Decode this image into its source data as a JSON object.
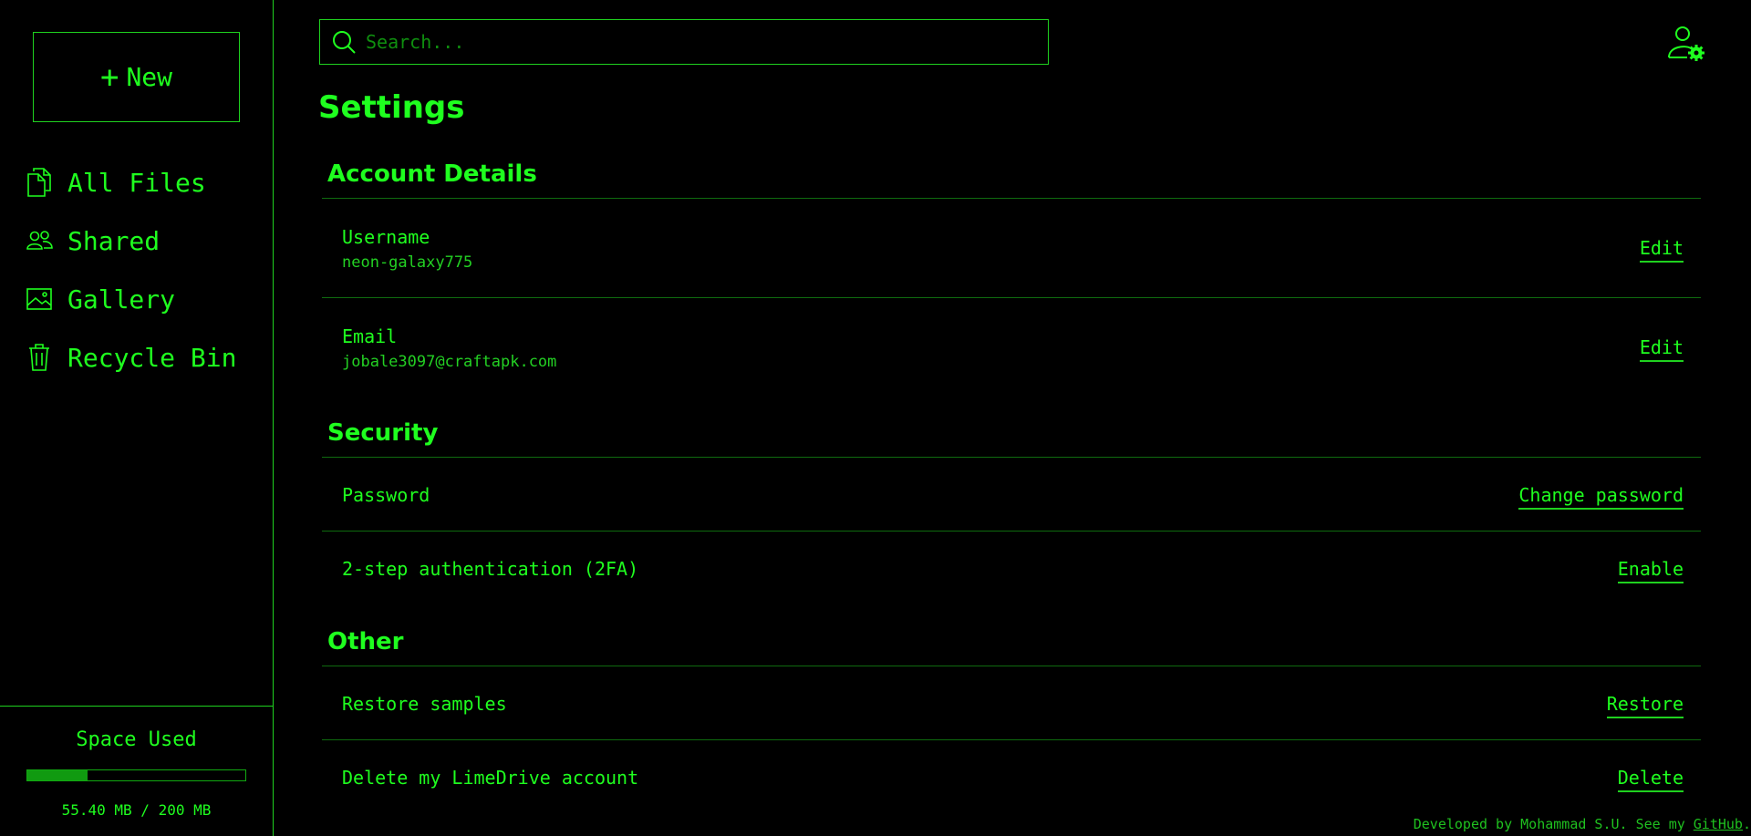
{
  "sidebar": {
    "new_label": "New",
    "items": [
      {
        "label": "All Files",
        "icon": "files-icon"
      },
      {
        "label": "Shared",
        "icon": "users-icon"
      },
      {
        "label": "Gallery",
        "icon": "image-icon"
      },
      {
        "label": "Recycle Bin",
        "icon": "trash-icon"
      }
    ],
    "space": {
      "title": "Space Used",
      "text": "55.40 MB / 200 MB",
      "used_fraction": 0.277
    }
  },
  "header": {
    "search_placeholder": "Search...",
    "user_settings_icon": "user-gear-icon"
  },
  "page_title": "Settings",
  "sections": {
    "account": {
      "title": "Account Details",
      "username": {
        "label": "Username",
        "value": "neon-galaxy775",
        "action": "Edit"
      },
      "email": {
        "label": "Email",
        "value": "jobale3097@craftapk.com",
        "action": "Edit"
      }
    },
    "security": {
      "title": "Security",
      "password": {
        "label": "Password",
        "action": "Change password"
      },
      "twofa": {
        "label": "2-step authentication (2FA)",
        "action": "Enable"
      }
    },
    "other": {
      "title": "Other",
      "restore": {
        "label": "Restore samples",
        "action": "Restore"
      },
      "delete": {
        "label": "Delete my LimeDrive account",
        "action": "Delete"
      }
    }
  },
  "footer": {
    "text": "Developed by Mohammad S.U. See my ",
    "link": "GitHub",
    "end": "."
  },
  "colors": {
    "accent": "#1fff1f",
    "background": "#000000",
    "divider": "#0f6b0f"
  }
}
